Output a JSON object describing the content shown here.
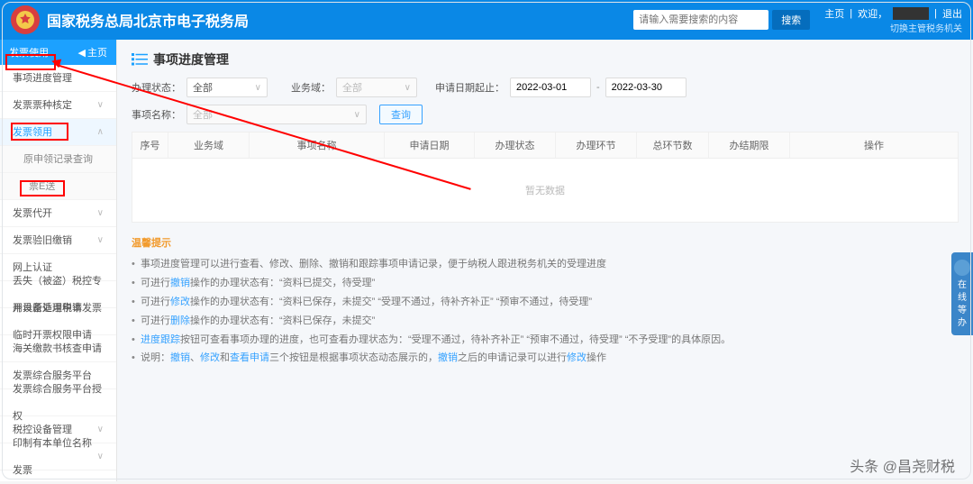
{
  "header": {
    "title": "国家税务总局北京市电子税务局",
    "search_placeholder": "请输入需要搜索的内容",
    "search_button": "搜索",
    "links": {
      "home": "主页",
      "welcome": "欢迎，",
      "logout": "退出",
      "switch": "切换主管税务机关"
    }
  },
  "sidebar": {
    "top_left": "发票使用",
    "home_label": "主页",
    "items": [
      {
        "label": "事项进度管理",
        "chev": ""
      },
      {
        "label": "发票票种核定",
        "chev": "∨"
      },
      {
        "label": "发票领用",
        "chev": "∧",
        "active": true
      },
      {
        "label": "原申领记录查询",
        "chev": "",
        "sub": true
      },
      {
        "label": "票E送",
        "chev": "",
        "sub2": true
      },
      {
        "label": "发票代开",
        "chev": "∨"
      },
      {
        "label": "发票验旧缴销",
        "chev": "∨"
      },
      {
        "label": "网上认证",
        "chev": ""
      },
      {
        "label": "丢失（被盗）税控专用设备处理申请",
        "chev": ""
      },
      {
        "label": "开具原适用税率发票临时开票权限申请",
        "chev": ""
      },
      {
        "label": "海关缴款书核查申请",
        "chev": ""
      },
      {
        "label": "发票综合服务平台",
        "chev": ""
      },
      {
        "label": "发票综合服务平台授权",
        "chev": ""
      },
      {
        "label": "税控设备管理",
        "chev": "∨"
      },
      {
        "label": "印制有本单位名称发票",
        "chev": "∨"
      }
    ]
  },
  "main": {
    "title": "事项进度管理",
    "filters": {
      "status_label": "办理状态：",
      "status_value": "全部",
      "domain_label": "业务域：",
      "domain_value": "全部",
      "date_label": "申请日期起止：",
      "date_from": "2022-03-01",
      "date_to": "2022-03-30",
      "name_label": "事项名称：",
      "name_value": "全部",
      "query_btn": "查询"
    },
    "table": {
      "columns": [
        "序号",
        "业务域",
        "事项名称",
        "申请日期",
        "办理状态",
        "办理环节",
        "总环节数",
        "办结期限",
        "操作"
      ],
      "empty": "暂无数据"
    },
    "tips_title": "温馨提示",
    "tips": [
      {
        "parts": [
          {
            "t": "事项进度管理可以进行查看、修改、删除、撤销和跟踪事项申请记录，便于纳税人跟进税务机关的受理进度"
          }
        ]
      },
      {
        "parts": [
          {
            "t": "可进行"
          },
          {
            "t": "撤销",
            "link": true
          },
          {
            "t": "操作的办理状态有：“资料已提交，待受理”"
          }
        ]
      },
      {
        "parts": [
          {
            "t": "可进行"
          },
          {
            "t": "修改",
            "link": true
          },
          {
            "t": "操作的办理状态有：“资料已保存，未提交”  “受理不通过，待补齐补正”  “预审不通过，待受理”"
          }
        ]
      },
      {
        "parts": [
          {
            "t": "可进行"
          },
          {
            "t": "删除",
            "link": true
          },
          {
            "t": "操作的办理状态有：“资料已保存，未提交”"
          }
        ]
      },
      {
        "parts": [
          {
            "t": "进度跟踪",
            "link": true
          },
          {
            "t": "按钮可查看事项办理的进度，也可查看办理状态为：“受理不通过，待补齐补正”  “预审不通过，待受理”  “不予受理”的具体原因。"
          }
        ]
      },
      {
        "parts": [
          {
            "t": "说明："
          },
          {
            "t": "撤销",
            "link": true
          },
          {
            "t": "、"
          },
          {
            "t": "修改",
            "link": true
          },
          {
            "t": "和"
          },
          {
            "t": "查看申请",
            "link": true
          },
          {
            "t": "三个按钮是根据事项状态动态展示的，"
          },
          {
            "t": "撤销",
            "link": true
          },
          {
            "t": "之后的申请记录可以进行"
          },
          {
            "t": "修改",
            "link": true
          },
          {
            "t": "操作"
          }
        ]
      }
    ]
  },
  "float_helper": "在线等办",
  "watermark": "头条 @昌尧财税"
}
